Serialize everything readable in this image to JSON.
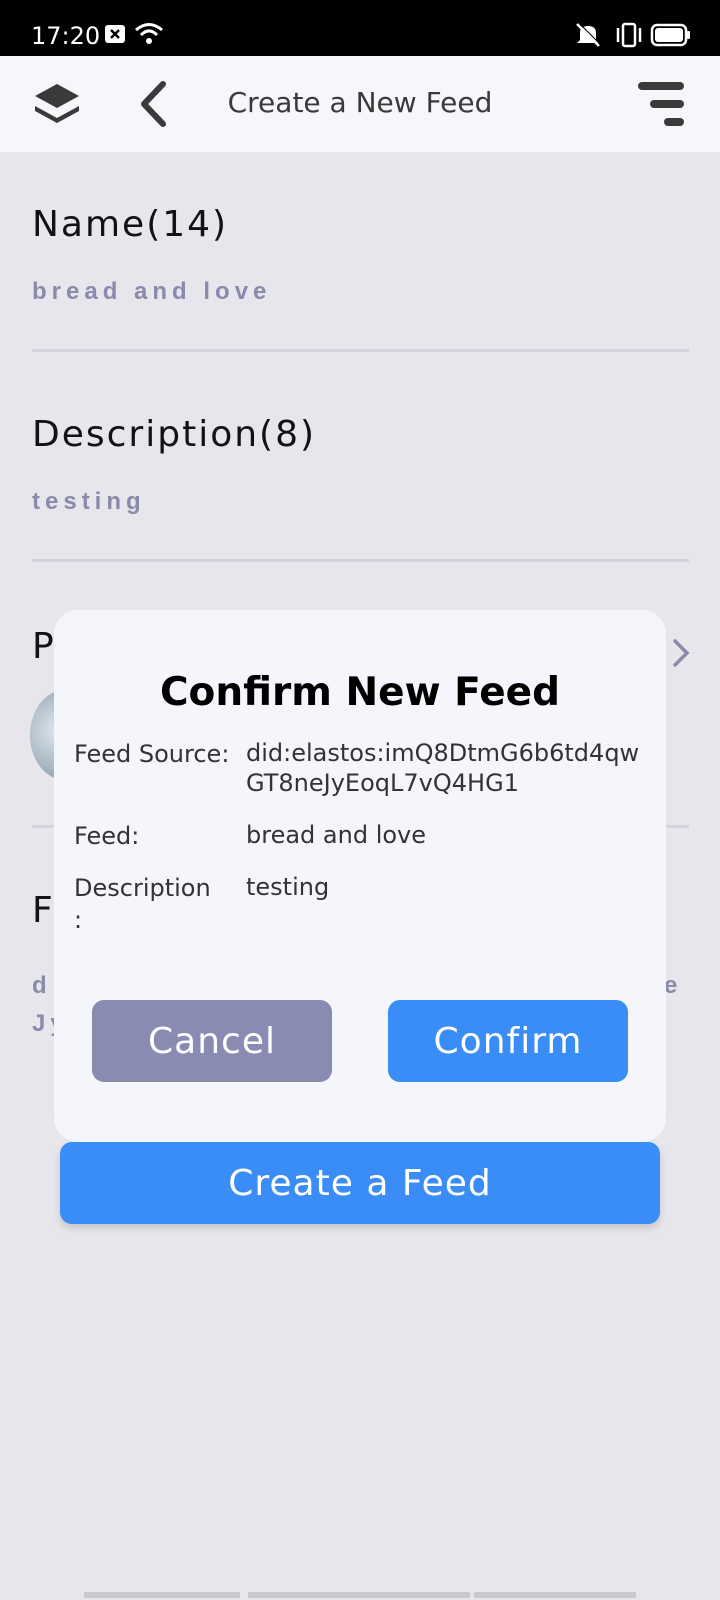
{
  "status_bar": {
    "time": "17:20",
    "icons": [
      "notification-icon",
      "wifi-icon",
      "mute-icon",
      "vibrate-icon",
      "battery-icon"
    ]
  },
  "header": {
    "title": "Create a New Feed",
    "icons": [
      "app-logo-icon",
      "back-icon",
      "menu-icon"
    ]
  },
  "form": {
    "name": {
      "label": "Name(14)",
      "value": "bread and love"
    },
    "description": {
      "label": "Description(8)",
      "value": "testing"
    },
    "picture": {
      "label_partial": "P"
    },
    "feed_source": {
      "label_partial": "F",
      "value_partial_1": "d",
      "value_partial_2": "Jy",
      "value_partial_end": "e"
    }
  },
  "create_button": "Create a Feed",
  "dialog": {
    "title": "Confirm New Feed",
    "rows": [
      {
        "label": "Feed Source:",
        "value": "did:elastos:imQ8DtmG6b6td4qwGT8neJyEoqL7vQ4HG1"
      },
      {
        "label": "Feed:",
        "value": "bread and love"
      },
      {
        "label": "Description\n:",
        "value": "testing"
      }
    ],
    "cancel_label": "Cancel",
    "confirm_label": "Confirm"
  },
  "colors": {
    "accent": "#3a8cf7",
    "cancel": "#8a8bb3",
    "muted_value": "#8a8aaa"
  }
}
